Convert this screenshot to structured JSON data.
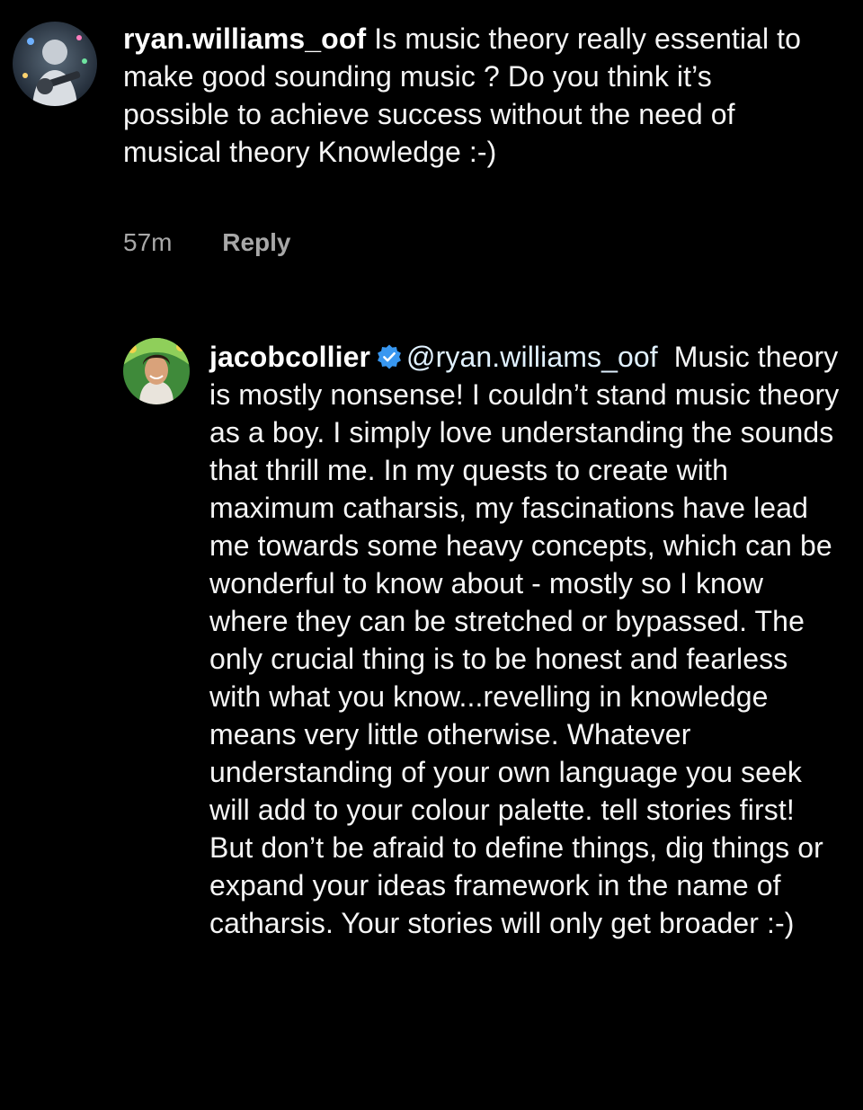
{
  "comments": [
    {
      "username": "ryan.williams_oof",
      "text": "Is music theory really essential to make good sounding music ? Do you think it’s possible to achieve success without the need of musical theory Knowledge :-)",
      "time": "57m",
      "reply_label": "Reply",
      "avatar_icon": "user-avatar-guitarist"
    },
    {
      "username": "jacobcollier",
      "verified": true,
      "verified_icon": "verified-badge-icon",
      "verified_color": "#3897f0",
      "mention": "@ryan.williams_oof",
      "text": "Music theory is mostly nonsense! I couldn’t stand music theory as a boy. I simply love understanding the sounds that thrill me. In my quests to create with maximum catharsis, my fascinations have lead me towards some heavy concepts, which can be wonderful to know about - mostly so I know where they can be stretched or bypassed. The only crucial thing is to be honest and fearless with what you know...revelling in knowledge means very little otherwise. Whatever understanding of your own language you seek will add to your colour palette. tell stories first! But don’t be afraid to define things, dig things or expand your ideas framework in the name of catharsis. Your stories will only get broader :-)",
      "avatar_icon": "user-avatar-smiling-man"
    }
  ],
  "colors": {
    "background": "#000000",
    "text": "#f5f5f5",
    "secondary_text": "#a8a8a8"
  }
}
